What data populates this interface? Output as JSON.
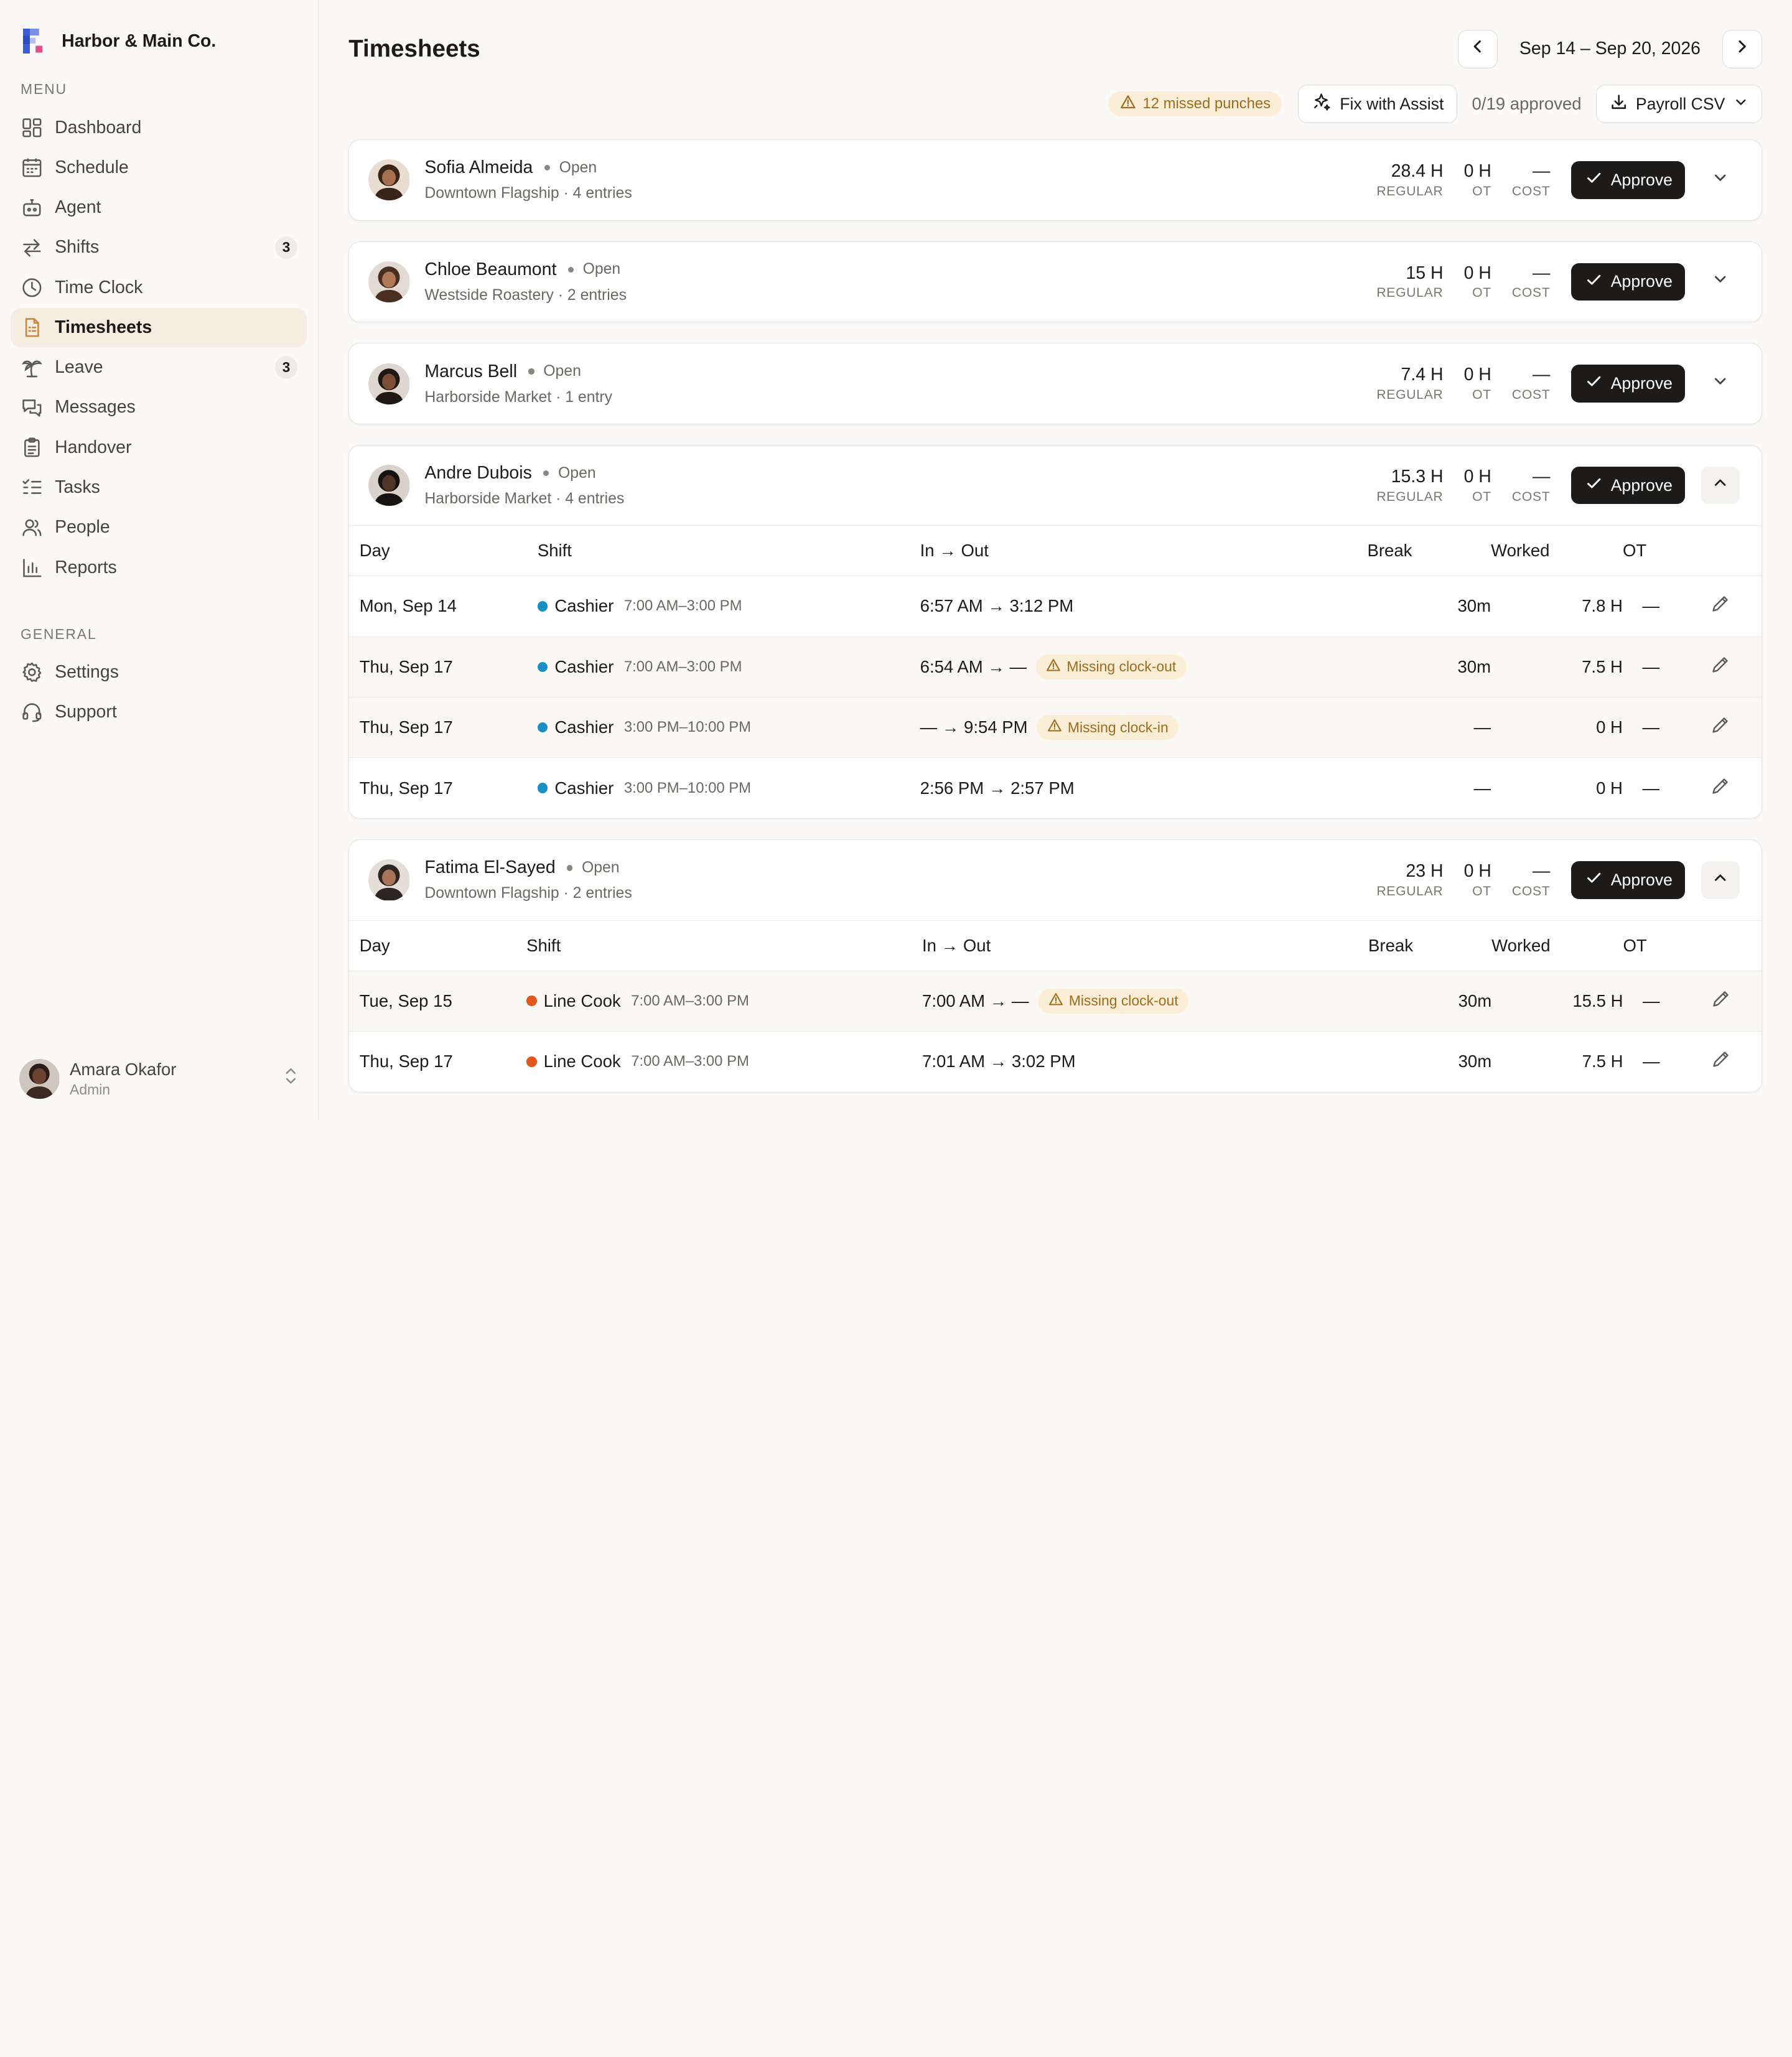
{
  "brand": {
    "name": "Harbor & Main Co."
  },
  "sidebar": {
    "menu_label": "MENU",
    "general_label": "GENERAL",
    "menu": [
      {
        "label": "Dashboard",
        "icon": "dashboard-icon"
      },
      {
        "label": "Schedule",
        "icon": "calendar-icon"
      },
      {
        "label": "Agent",
        "icon": "robot-icon"
      },
      {
        "label": "Shifts",
        "icon": "swap-icon",
        "badge": "3"
      },
      {
        "label": "Time Clock",
        "icon": "clock-icon"
      },
      {
        "label": "Timesheets",
        "icon": "document-icon",
        "active": true
      },
      {
        "label": "Leave",
        "icon": "palm-tree-icon",
        "badge": "3"
      },
      {
        "label": "Messages",
        "icon": "chat-icon"
      },
      {
        "label": "Handover",
        "icon": "clipboard-icon"
      },
      {
        "label": "Tasks",
        "icon": "task-list-icon"
      },
      {
        "label": "People",
        "icon": "people-icon"
      },
      {
        "label": "Reports",
        "icon": "bar-chart-icon"
      }
    ],
    "general": [
      {
        "label": "Settings",
        "icon": "gear-icon"
      },
      {
        "label": "Support",
        "icon": "headset-icon"
      }
    ],
    "user": {
      "name": "Amara Okafor",
      "role": "Admin"
    }
  },
  "header": {
    "title": "Timesheets",
    "date_range": "Sep 14 – Sep 20, 2026",
    "missed_punches": "12 missed punches",
    "fix_button": "Fix with Assist",
    "approved": "0/19 approved",
    "export_button": "Payroll CSV"
  },
  "labels": {
    "regular": "REGULAR",
    "ot": "OT",
    "cost": "COST",
    "approve": "Approve",
    "col_day": "Day",
    "col_shift": "Shift",
    "col_inout": "In → Out",
    "col_break": "Break",
    "col_worked": "Worked",
    "col_ot": "OT"
  },
  "colors": {
    "accent": "#c7883b",
    "cashier": "#1a8fc4",
    "line_cook": "#e0581c",
    "warning_bg": "#fbeed7",
    "warning_text": "#9e6a1d"
  },
  "employees": [
    {
      "name": "Sofia Almeida",
      "status": "Open",
      "sub": "Downtown Flagship · 4 entries",
      "regular": "28.4 H",
      "ot": "0 H",
      "cost": "—",
      "expanded": false
    },
    {
      "name": "Chloe Beaumont",
      "status": "Open",
      "sub": "Westside Roastery · 2 entries",
      "regular": "15 H",
      "ot": "0 H",
      "cost": "—",
      "expanded": false
    },
    {
      "name": "Marcus Bell",
      "status": "Open",
      "sub": "Harborside Market · 1 entry",
      "regular": "7.4 H",
      "ot": "0 H",
      "cost": "—",
      "expanded": false
    },
    {
      "name": "Andre Dubois",
      "status": "Open",
      "sub": "Harborside Market · 4 entries",
      "regular": "15.3 H",
      "ot": "0 H",
      "cost": "—",
      "expanded": true,
      "rows": [
        {
          "day": "Mon, Sep 14",
          "role": "Cashier",
          "time": "7:00 AM–3:00 PM",
          "inout": "6:57 AM → 3:12 PM",
          "warning": "",
          "break": "30m",
          "worked": "7.8 H",
          "ot": "—"
        },
        {
          "day": "Thu, Sep 17",
          "role": "Cashier",
          "time": "7:00 AM–3:00 PM",
          "inout": "6:54 AM → —",
          "warning": "Missing clock-out",
          "break": "30m",
          "worked": "7.5 H",
          "ot": "—"
        },
        {
          "day": "Thu, Sep 17",
          "role": "Cashier",
          "time": "3:00 PM–10:00 PM",
          "inout": "— → 9:54 PM",
          "warning": "Missing clock-in",
          "break": "—",
          "worked": "0 H",
          "ot": "—"
        },
        {
          "day": "Thu, Sep 17",
          "role": "Cashier",
          "time": "3:00 PM–10:00 PM",
          "inout": "2:56 PM → 2:57 PM",
          "warning": "",
          "break": "—",
          "worked": "0 H",
          "ot": "—"
        }
      ]
    },
    {
      "name": "Fatima El-Sayed",
      "status": "Open",
      "sub": "Downtown Flagship · 2 entries",
      "regular": "23 H",
      "ot": "0 H",
      "cost": "—",
      "expanded": true,
      "rows": [
        {
          "day": "Tue, Sep 15",
          "role": "Line Cook",
          "time": "7:00 AM–3:00 PM",
          "inout": "7:00 AM → —",
          "warning": "Missing clock-out",
          "break": "30m",
          "worked": "15.5 H",
          "ot": "—"
        },
        {
          "day": "Thu, Sep 17",
          "role": "Line Cook",
          "time": "7:00 AM–3:00 PM",
          "inout": "7:01 AM → 3:02 PM",
          "warning": "",
          "break": "30m",
          "worked": "7.5 H",
          "ot": "—"
        }
      ]
    }
  ]
}
